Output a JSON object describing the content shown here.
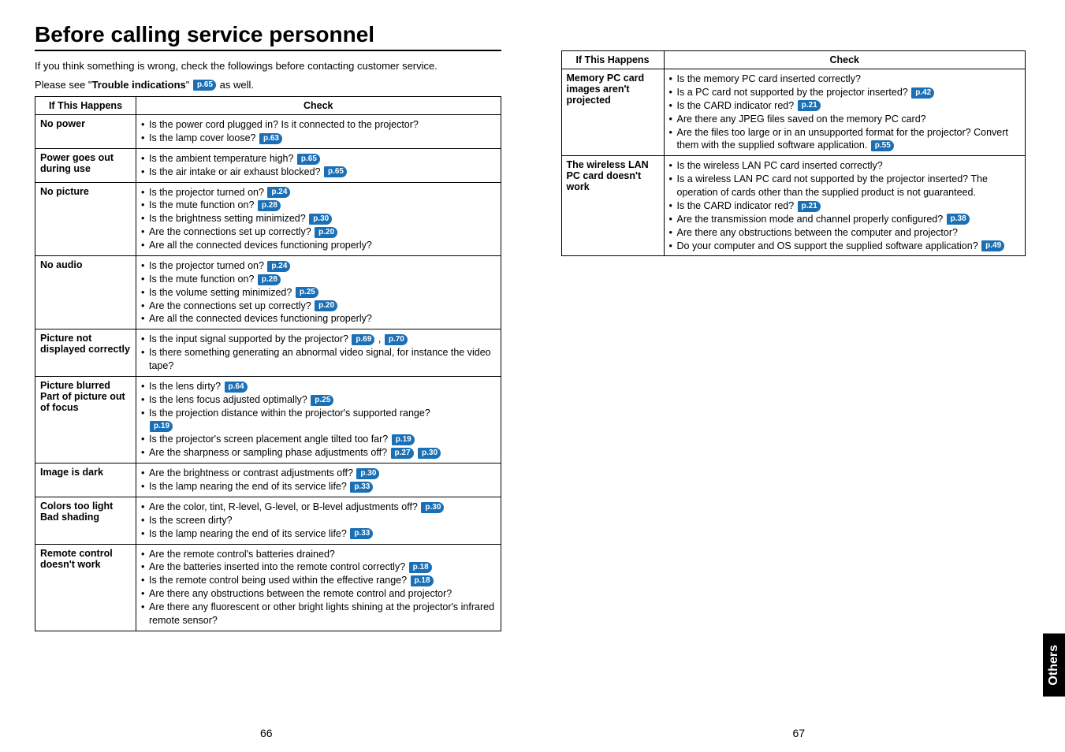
{
  "title": "Before calling service personnel",
  "intro1": "If you think something is wrong, check the followings before contacting customer service.",
  "intro2a": "Please see \"",
  "intro2b": "Trouble indications",
  "intro2c": "\" ",
  "intro2ref": "p.65",
  "intro2d": " as well.",
  "headers": {
    "col1": "If  This Happens",
    "col2": "Check"
  },
  "leftRows": [
    {
      "issue": "No power",
      "items": [
        {
          "text": "Is the power cord plugged in? Is it connected to the projector?"
        },
        {
          "text": "Is the lamp cover loose? ",
          "refs": [
            "p.63"
          ]
        }
      ]
    },
    {
      "issue": "Power goes out during use",
      "items": [
        {
          "text": "Is the ambient temperature high? ",
          "refs": [
            "p.65"
          ]
        },
        {
          "text": "Is the air intake or air exhaust blocked? ",
          "refs": [
            "p.65"
          ]
        }
      ]
    },
    {
      "issue": "No picture",
      "items": [
        {
          "text": "Is the projector turned on? ",
          "refs": [
            "p.24"
          ]
        },
        {
          "text": "Is the mute function on? ",
          "refs": [
            "p.28"
          ]
        },
        {
          "text": "Is the brightness setting minimized? ",
          "refs": [
            "p.30"
          ]
        },
        {
          "text": "Are the connections set up correctly? ",
          "refs": [
            "p.20"
          ]
        },
        {
          "text": "Are all the connected devices functioning properly?"
        }
      ]
    },
    {
      "issue": "No audio",
      "items": [
        {
          "text": "Is the projector turned on? ",
          "refs": [
            "p.24"
          ]
        },
        {
          "text": "Is the mute function on? ",
          "refs": [
            "p.28"
          ]
        },
        {
          "text": "Is the volume setting minimized? ",
          "refs": [
            "p.25"
          ]
        },
        {
          "text": "Are the connections set up correctly? ",
          "refs": [
            "p.20"
          ]
        },
        {
          "text": "Are all the connected devices functioning properly?"
        }
      ]
    },
    {
      "issue": "Picture not displayed correctly",
      "items": [
        {
          "text": "Is the input signal supported by the projector? ",
          "refs": [
            "p.69",
            "p.70"
          ],
          "sep": " , "
        },
        {
          "text": "Is there something generating an abnormal video signal, for instance the video tape?"
        }
      ]
    },
    {
      "issue": "Picture blurred Part of picture out of focus",
      "items": [
        {
          "text": "Is the lens dirty? ",
          "refs": [
            "p.64"
          ]
        },
        {
          "text": "Is the lens focus adjusted optimally? ",
          "refs": [
            "p.25"
          ]
        },
        {
          "text": "Is the projection distance within the projector's supported range? ",
          "refs": [
            "p.19"
          ],
          "refBelow": true
        },
        {
          "text": "Is the projector's screen placement angle tilted too far? ",
          "refs": [
            "p.19"
          ]
        },
        {
          "text": "Are the sharpness or sampling phase adjustments off? ",
          "refs": [
            "p.27",
            "p.30"
          ]
        }
      ]
    },
    {
      "issue": "Image is dark",
      "items": [
        {
          "text": "Are the brightness or contrast adjustments off? ",
          "refs": [
            "p.30"
          ]
        },
        {
          "text": "Is the lamp nearing the end of its service life? ",
          "refs": [
            "p.33"
          ]
        }
      ]
    },
    {
      "issue": "Colors too light Bad shading",
      "items": [
        {
          "text": "Are the color, tint, R-level, G-level, or B-level adjustments off? ",
          "refs": [
            "p.30"
          ]
        },
        {
          "text": "Is the screen dirty?"
        },
        {
          "text": "Is the lamp nearing the end of its service life? ",
          "refs": [
            "p.33"
          ]
        }
      ]
    },
    {
      "issue": "Remote control doesn't work",
      "items": [
        {
          "text": "Are the remote control's batteries drained?"
        },
        {
          "text": "Are the batteries inserted into the remote control correctly? ",
          "refs": [
            "p.18"
          ]
        },
        {
          "text": "Is the remote control being used within the effective range? ",
          "refs": [
            "p.18"
          ]
        },
        {
          "text": "Are there any obstructions between the remote control and projector?"
        },
        {
          "text": "Are there any fluorescent or other bright lights shining at the projector's infrared remote sensor?"
        }
      ]
    }
  ],
  "rightRows": [
    {
      "issue": "Memory PC card images aren't projected",
      "items": [
        {
          "text": "Is the memory PC card inserted correctly?"
        },
        {
          "text": "Is a PC card not supported by the projector inserted? ",
          "refs": [
            "p.42"
          ]
        },
        {
          "text": "Is the CARD indicator red? ",
          "refs": [
            "p.21"
          ]
        },
        {
          "text": "Are there any JPEG files saved on the memory PC card?"
        },
        {
          "text": "Are the files too large or in an unsupported format for the projector? Convert them with the supplied software application. ",
          "refs": [
            "p.55"
          ]
        }
      ]
    },
    {
      "issue": "The wireless LAN PC card doesn't work",
      "items": [
        {
          "text": "Is the wireless LAN PC card inserted correctly?"
        },
        {
          "text": "Is a wireless LAN PC card not supported by the projector inserted? The operation of cards other than the supplied product is not guaranteed."
        },
        {
          "text": "Is the CARD indicator red? ",
          "refs": [
            "p.21"
          ]
        },
        {
          "text": "Are the transmission mode and channel properly configured? ",
          "refs": [
            "p.38"
          ]
        },
        {
          "text": "Are there any obstructions between the computer and projector?"
        },
        {
          "text": "Do your computer and OS support the supplied software application? ",
          "refs": [
            "p.49"
          ]
        }
      ]
    }
  ],
  "pageNumLeft": "66",
  "pageNumRight": "67",
  "sideTab": "Others"
}
